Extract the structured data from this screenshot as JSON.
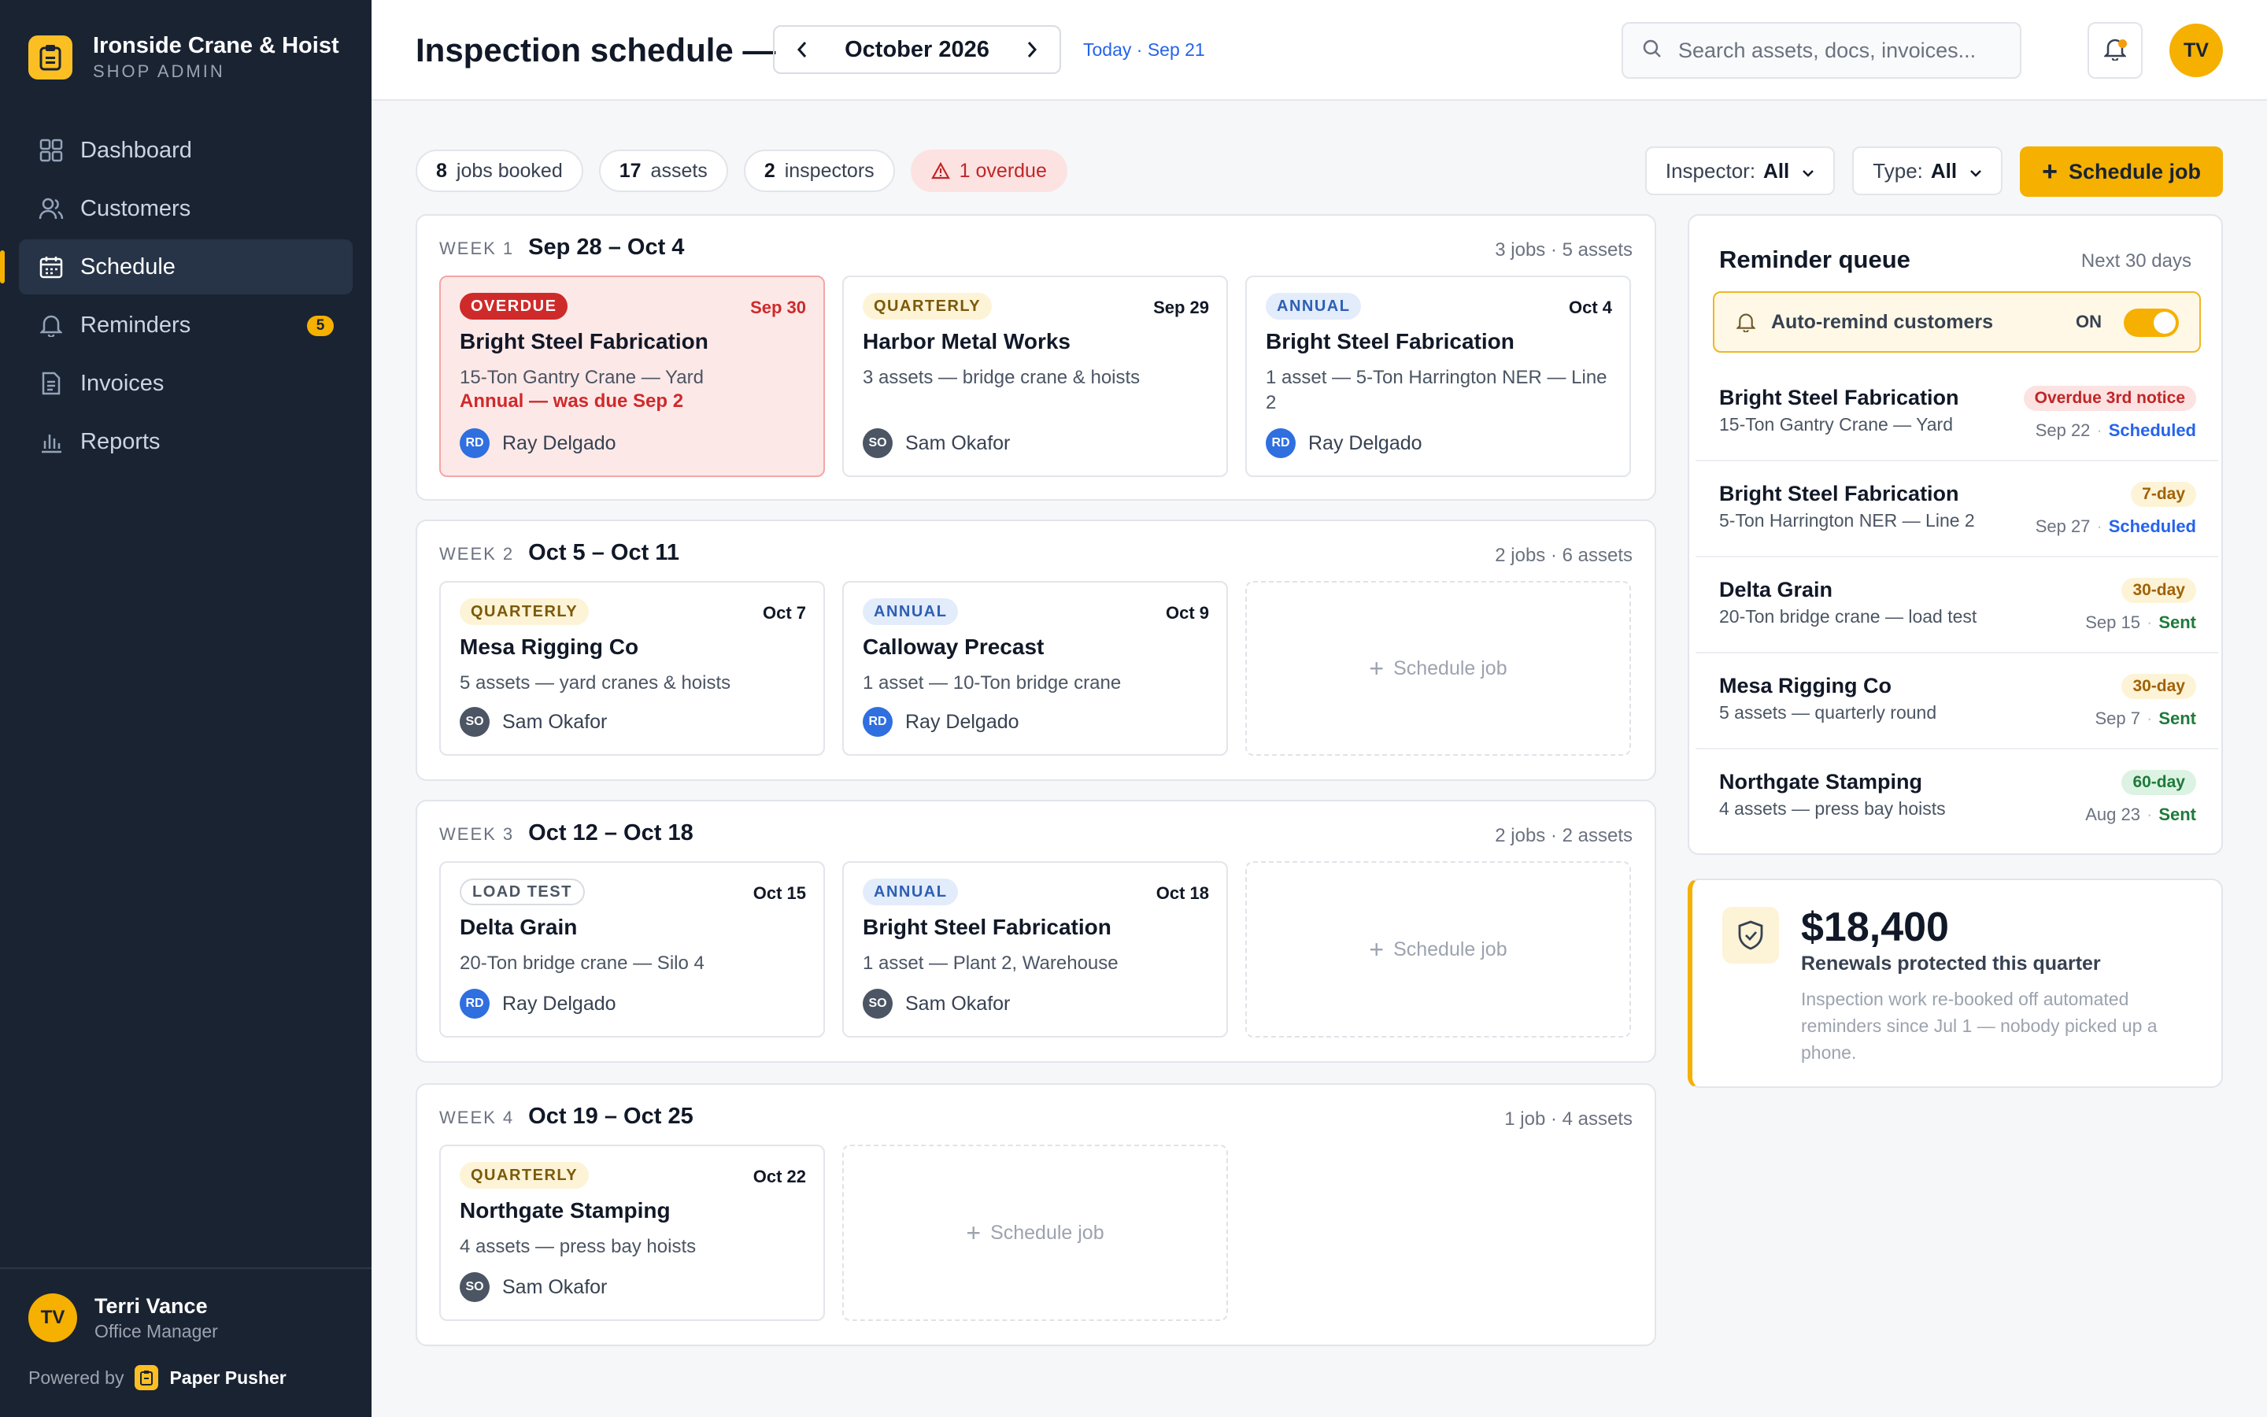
{
  "brand": {
    "name": "Ironside Crane & Hoist",
    "subtitle": "SHOP ADMIN"
  },
  "nav": [
    {
      "label": "Dashboard",
      "icon": "grid-icon"
    },
    {
      "label": "Customers",
      "icon": "users-icon"
    },
    {
      "label": "Schedule",
      "icon": "calendar-icon",
      "active": true
    },
    {
      "label": "Reminders",
      "icon": "bell-icon",
      "badge": "5"
    },
    {
      "label": "Invoices",
      "icon": "document-icon"
    },
    {
      "label": "Reports",
      "icon": "bar-chart-icon"
    }
  ],
  "user": {
    "initials": "TV",
    "name": "Terri Vance",
    "role": "Office Manager"
  },
  "powered": {
    "prefix": "Powered by",
    "product": "Paper Pusher"
  },
  "header": {
    "title": "Inspection schedule —",
    "month": "October 2026",
    "today": "Today · Sep 21",
    "search_placeholder": "Search assets, docs, invoices...",
    "avatar": "TV"
  },
  "stats": [
    {
      "num": "8",
      "label": "jobs booked"
    },
    {
      "num": "17",
      "label": "assets"
    },
    {
      "num": "2",
      "label": "inspectors"
    },
    {
      "label": "1 overdue",
      "warn": true
    }
  ],
  "filters": {
    "inspector_label": "Inspector:",
    "inspector_value": "All",
    "type_label": "Type:",
    "type_value": "All",
    "schedule_btn": "Schedule job"
  },
  "weeks": [
    {
      "label": "WEEK 1",
      "range": "Sep 28 – Oct 4",
      "count": "3 jobs · 5 assets",
      "jobs": [
        {
          "tag": "OVERDUE",
          "date": "Sep 30",
          "name": "Bright Steel Fabrication",
          "desc": "15-Ton Gantry Crane — Yard",
          "note": "Annual — was due Sep 2",
          "inspector": "Ray Delgado",
          "initials": "RD"
        },
        {
          "tag": "QUARTERLY",
          "date": "Sep 29",
          "name": "Harbor Metal Works",
          "desc": "3 assets — bridge crane & hoists",
          "inspector": "Sam Okafor",
          "initials": "SO"
        },
        {
          "tag": "ANNUAL",
          "date": "Oct 4",
          "name": "Bright Steel Fabrication",
          "desc": "1 asset — 5-Ton Harrington NER — Line 2",
          "inspector": "Ray Delgado",
          "initials": "RD"
        }
      ]
    },
    {
      "label": "WEEK 2",
      "range": "Oct 5 – Oct 11",
      "count": "2 jobs · 6 assets",
      "jobs": [
        {
          "tag": "QUARTERLY",
          "date": "Oct 7",
          "name": "Mesa Rigging Co",
          "desc": "5 assets — yard cranes & hoists",
          "inspector": "Sam Okafor",
          "initials": "SO"
        },
        {
          "tag": "ANNUAL",
          "date": "Oct 9",
          "name": "Calloway Precast",
          "desc": "1 asset — 10-Ton bridge crane",
          "inspector": "Ray Delgado",
          "initials": "RD"
        }
      ],
      "empty": "Schedule job"
    },
    {
      "label": "WEEK 3",
      "range": "Oct 12 – Oct 18",
      "count": "2 jobs · 2 assets",
      "jobs": [
        {
          "tag": "LOAD TEST",
          "date": "Oct 15",
          "name": "Delta Grain",
          "desc": "20-Ton bridge crane — Silo 4",
          "inspector": "Ray Delgado",
          "initials": "RD"
        },
        {
          "tag": "ANNUAL",
          "date": "Oct 18",
          "name": "Bright Steel Fabrication",
          "desc": "1 asset — Plant 2, Warehouse",
          "inspector": "Sam Okafor",
          "initials": "SO"
        }
      ],
      "empty": "Schedule job"
    },
    {
      "label": "WEEK 4",
      "range": "Oct 19 – Oct 25",
      "count": "1 job · 4 assets",
      "jobs": [
        {
          "tag": "QUARTERLY",
          "date": "Oct 22",
          "name": "Northgate Stamping",
          "desc": "4 assets — press bay hoists",
          "inspector": "Sam Okafor",
          "initials": "SO"
        }
      ],
      "empty": "Schedule job"
    }
  ],
  "queue": {
    "title": "Reminder queue",
    "subtitle": "Next 30 days",
    "auto_label": "Auto-remind customers",
    "auto_state": "ON",
    "items": [
      {
        "name": "Bright Steel Fabrication",
        "desc": "15-Ton Gantry Crane — Yard",
        "badge": "Overdue 3rd notice",
        "date": "Sep 22",
        "status": "Scheduled"
      },
      {
        "name": "Bright Steel Fabrication",
        "desc": "5-Ton Harrington NER — Line 2",
        "badge": "7-day",
        "date": "Sep 27",
        "status": "Scheduled"
      },
      {
        "name": "Delta Grain",
        "desc": "20-Ton bridge crane — load test",
        "badge": "30-day",
        "date": "Sep 15",
        "status": "Sent"
      },
      {
        "name": "Mesa Rigging Co",
        "desc": "5 assets — quarterly round",
        "badge": "30-day",
        "date": "Sep 7",
        "status": "Sent"
      },
      {
        "name": "Northgate Stamping",
        "desc": "4 assets — press bay hoists",
        "badge": "60-day",
        "date": "Aug 23",
        "status": "Sent"
      }
    ]
  },
  "renewals": {
    "amount": "$18,400",
    "label": "Renewals protected this quarter",
    "desc": "Inspection work re-booked off automated reminders since Jul 1 — nobody picked up a phone."
  },
  "colors": {
    "accent": "#f5b000",
    "sidebar": "#1a2332",
    "danger": "#cf2a2a",
    "link": "#2563eb",
    "success": "#1f7a3b"
  }
}
